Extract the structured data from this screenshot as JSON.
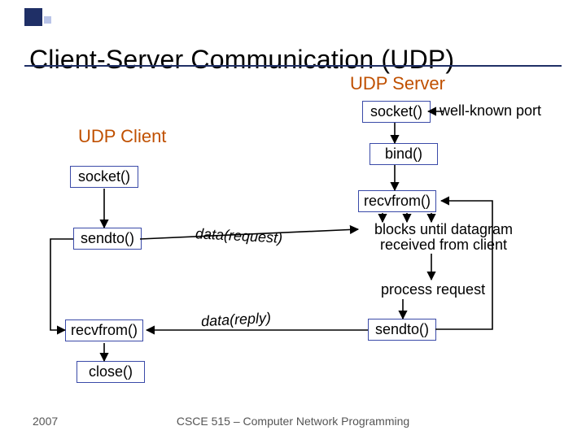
{
  "title": "Client-Server Communication (UDP)",
  "server": {
    "label": "UDP Server",
    "socket": "socket()",
    "bind": "bind()",
    "recvfrom": "recvfrom()",
    "sendto": "sendto()",
    "well_known_port": "well-known port",
    "blocks_line1": "blocks until datagram",
    "blocks_line2": "received from client",
    "process": "process request"
  },
  "client": {
    "label": "UDP Client",
    "socket": "socket()",
    "sendto": "sendto()",
    "recvfrom": "recvfrom()",
    "close": "close()"
  },
  "edges": {
    "request": "data(request)",
    "reply": "data(reply)"
  },
  "footer": {
    "year": "2007",
    "course": "CSCE 515 – Computer Network Programming"
  },
  "chart_data": {
    "type": "diagram",
    "title": "Client-Server Communication (UDP)",
    "nodes": [
      {
        "id": "srv_socket",
        "side": "server",
        "label": "socket()",
        "note": "well-known port"
      },
      {
        "id": "srv_bind",
        "side": "server",
        "label": "bind()"
      },
      {
        "id": "srv_recvfrom",
        "side": "server",
        "label": "recvfrom()",
        "note": "blocks until datagram received from client"
      },
      {
        "id": "srv_process",
        "side": "server",
        "label": "process request",
        "kind": "text"
      },
      {
        "id": "srv_sendto",
        "side": "server",
        "label": "sendto()"
      },
      {
        "id": "cli_socket",
        "side": "client",
        "label": "socket()"
      },
      {
        "id": "cli_sendto",
        "side": "client",
        "label": "sendto()"
      },
      {
        "id": "cli_recvfrom",
        "side": "client",
        "label": "recvfrom()"
      },
      {
        "id": "cli_close",
        "side": "client",
        "label": "close()"
      }
    ],
    "edges": [
      {
        "from": "srv_socket",
        "to": "srv_bind"
      },
      {
        "from": "srv_bind",
        "to": "srv_recvfrom"
      },
      {
        "from": "srv_recvfrom",
        "to": "srv_process"
      },
      {
        "from": "srv_process",
        "to": "srv_sendto"
      },
      {
        "from": "srv_sendto",
        "to": "srv_recvfrom",
        "kind": "loop"
      },
      {
        "from": "cli_socket",
        "to": "cli_sendto"
      },
      {
        "from": "cli_sendto",
        "to": "srv_recvfrom",
        "label": "data(request)"
      },
      {
        "from": "srv_sendto",
        "to": "cli_recvfrom",
        "label": "data(reply)"
      },
      {
        "from": "cli_sendto",
        "to": "cli_recvfrom"
      },
      {
        "from": "cli_recvfrom",
        "to": "cli_close"
      }
    ]
  }
}
